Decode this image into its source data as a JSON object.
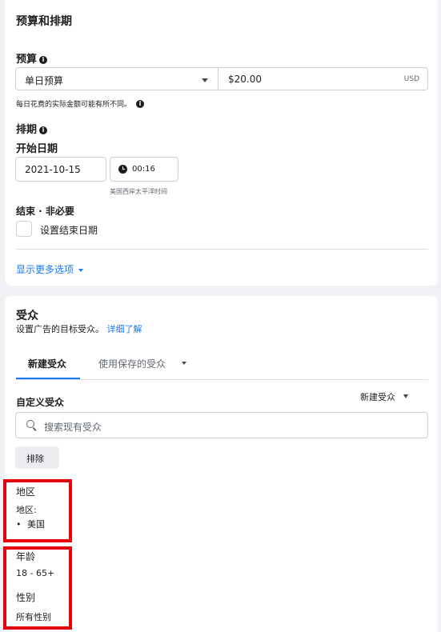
{
  "budget_schedule": {
    "section_title": "预算和排期",
    "budget_label": "预算",
    "budget_type": "单日预算",
    "budget_amount": "$20.00",
    "currency": "USD",
    "budget_note": "每日花费的实际金额可能有所不同。",
    "schedule_label": "排期",
    "start_date_label": "开始日期",
    "start_date": "2021-10-15",
    "start_time": "00:16",
    "timezone": "美国西岸太平洋时间",
    "end_label": "结束 · 非必要",
    "set_end_date_label": "设置结束日期",
    "more_options": "显示更多选项"
  },
  "audience": {
    "section_title": "受众",
    "subtitle": "设置广告的目标受众。",
    "learn_more": "详细了解",
    "tabs": [
      {
        "label": "新建受众",
        "active": true
      },
      {
        "label": "使用保存的受众",
        "active": false
      }
    ],
    "custom_audience_label": "自定义受众",
    "create_new_label": "新建受众",
    "search_placeholder": "搜索现有受众",
    "exclude_button": "排除",
    "region_title": "地区",
    "region_sub": "地区:",
    "region_value": "美国",
    "age_title": "年龄",
    "age_value": "18 - 65+",
    "gender_title": "性别",
    "gender_value": "所有性别"
  },
  "colors": {
    "link": "#1877f2",
    "highlight_border": "#e8000b"
  }
}
